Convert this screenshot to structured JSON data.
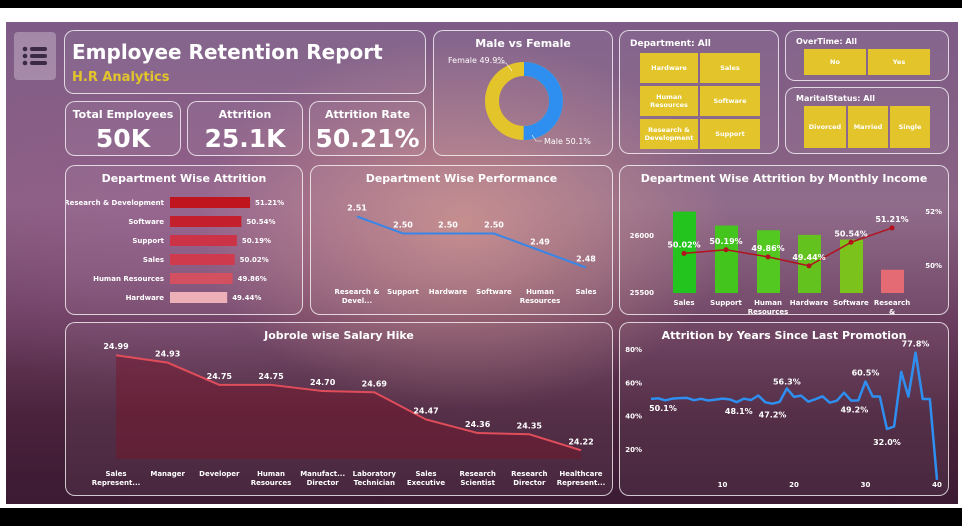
{
  "header": {
    "title": "Employee Retention Report",
    "subtitle": "H.R Analytics"
  },
  "kpis": [
    {
      "title": "Total Employees",
      "value": "50K"
    },
    {
      "title": "Attrition",
      "value": "25.1K"
    },
    {
      "title": "Attrition Rate",
      "value": "50.21%"
    }
  ],
  "gender": {
    "title": "Male vs Female",
    "female_label": "Female 49.9%",
    "male_label": "Male 50.1%",
    "female_pct": 49.9,
    "male_pct": 50.1,
    "colors": {
      "female": "#e3c52b",
      "male": "#2f8ff0"
    }
  },
  "department_slicer": {
    "title": "Department: All",
    "options": [
      "Hardware",
      "Sales",
      "Human Resources",
      "Software",
      "Research & Development",
      "Support"
    ]
  },
  "overtime_slicer": {
    "title": "OverTime: All",
    "options": [
      "No",
      "Yes"
    ]
  },
  "marital_slicer": {
    "title": "MaritalStatus: All",
    "options": [
      "Divorced",
      "Married",
      "Single"
    ]
  },
  "colors": {
    "slicer": "#e3c52b",
    "accent_red": "#c0141e",
    "line_blue": "#3a86e8",
    "bar_green": "#23c41e"
  },
  "chart_data": [
    {
      "type": "bar",
      "title": "Department Wise Attrition",
      "orientation": "horizontal",
      "categories": [
        "Research & Development",
        "Software",
        "Support",
        "Sales",
        "Human Resources",
        "Hardware"
      ],
      "values": [
        51.21,
        50.54,
        50.19,
        50.02,
        49.86,
        49.44
      ],
      "labels": [
        "51.21%",
        "50.54%",
        "50.19%",
        "50.02%",
        "49.86%",
        "49.44%"
      ],
      "colors": [
        "#c0141e",
        "#c41f2c",
        "#cc3346",
        "#cf3b4c",
        "#d2505f",
        "#eeb0b8"
      ]
    },
    {
      "type": "line",
      "title": "Department Wise Performance",
      "categories": [
        "Research & Devel...",
        "Support",
        "Hardware",
        "Software",
        "Human Resources",
        "Sales"
      ],
      "values": [
        2.51,
        2.5,
        2.5,
        2.5,
        2.49,
        2.48
      ],
      "labels": [
        "2.51",
        "2.50",
        "2.50",
        "2.50",
        "2.49",
        "2.48"
      ],
      "color": "#3a86e8"
    },
    {
      "type": "bar",
      "title": "Department Wise Attrition by Monthly Income",
      "categories": [
        "Sales",
        "Support",
        "Human Resources",
        "Hardware",
        "Software",
        "Research & Develo..."
      ],
      "bar_values": [
        26000,
        25880,
        25840,
        25800,
        25760,
        25500
      ],
      "bar_colors": [
        "#23c41e",
        "#43c51e",
        "#52c820",
        "#64c21f",
        "#7cc21d",
        "#e46a74"
      ],
      "line_values": [
        50.02,
        50.19,
        49.86,
        49.44,
        50.54,
        51.21
      ],
      "line_labels": [
        "50.02%",
        "50.19%",
        "49.86%",
        "49.44%",
        "50.54%",
        "51.21%"
      ],
      "y_ticks": [
        "26000",
        "25500"
      ],
      "y2_ticks": [
        "52%",
        "50%"
      ],
      "line_color": "#b3121c"
    },
    {
      "type": "area",
      "title": "Jobrole wise Salary Hike",
      "categories": [
        "Sales Represent...",
        "Manager",
        "Developer",
        "Human Resources",
        "Manufact... Director",
        "Laboratory Technician",
        "Sales Executive",
        "Research Scientist",
        "Research Director",
        "Healthcare Represent..."
      ],
      "values": [
        24.99,
        24.93,
        24.75,
        24.75,
        24.7,
        24.69,
        24.47,
        24.36,
        24.35,
        24.22
      ],
      "labels": [
        "24.99",
        "24.93",
        "24.75",
        "24.75",
        "24.70",
        "24.69",
        "24.47",
        "24.36",
        "24.35",
        "24.22"
      ],
      "color": "#e04d5a"
    },
    {
      "type": "line",
      "title": "Attrition by Years Since Last Promotion",
      "x": [
        0,
        1,
        2,
        3,
        4,
        5,
        6,
        7,
        8,
        9,
        10,
        11,
        12,
        13,
        14,
        15,
        16,
        17,
        18,
        19,
        20,
        21,
        22,
        23,
        24,
        25,
        26,
        27,
        28,
        29,
        30,
        31,
        32,
        33,
        34,
        35,
        36,
        37,
        38,
        39,
        40
      ],
      "values": [
        50.1,
        50.4,
        49.2,
        50.2,
        50.5,
        50.7,
        49.3,
        50.1,
        49.1,
        49.6,
        50.2,
        49.8,
        48.1,
        50.2,
        49.4,
        52.1,
        48.0,
        47.2,
        48.3,
        56.3,
        51.3,
        52.0,
        48.4,
        49.9,
        51.6,
        47.8,
        49.0,
        53.8,
        49.0,
        49.2,
        60.5,
        51.5,
        51.5,
        32.0,
        33.5,
        66.3,
        51.5,
        77.8,
        50.0,
        50.0,
        1.5
      ],
      "annotations": [
        {
          "x": 0,
          "label": "50.1%"
        },
        {
          "x": 12,
          "label": "48.1%"
        },
        {
          "x": 17,
          "label": "47.2%"
        },
        {
          "x": 19,
          "label": "56.3%"
        },
        {
          "x": 29,
          "label": "49.2%"
        },
        {
          "x": 30,
          "label": "60.5%"
        },
        {
          "x": 33,
          "label": "32.0%"
        },
        {
          "x": 37,
          "label": "77.8%"
        }
      ],
      "x_ticks": [
        "10",
        "20",
        "30",
        "40"
      ],
      "y_ticks": [
        "80%",
        "60%",
        "40%",
        "20%"
      ],
      "color": "#2f8ff0"
    }
  ]
}
